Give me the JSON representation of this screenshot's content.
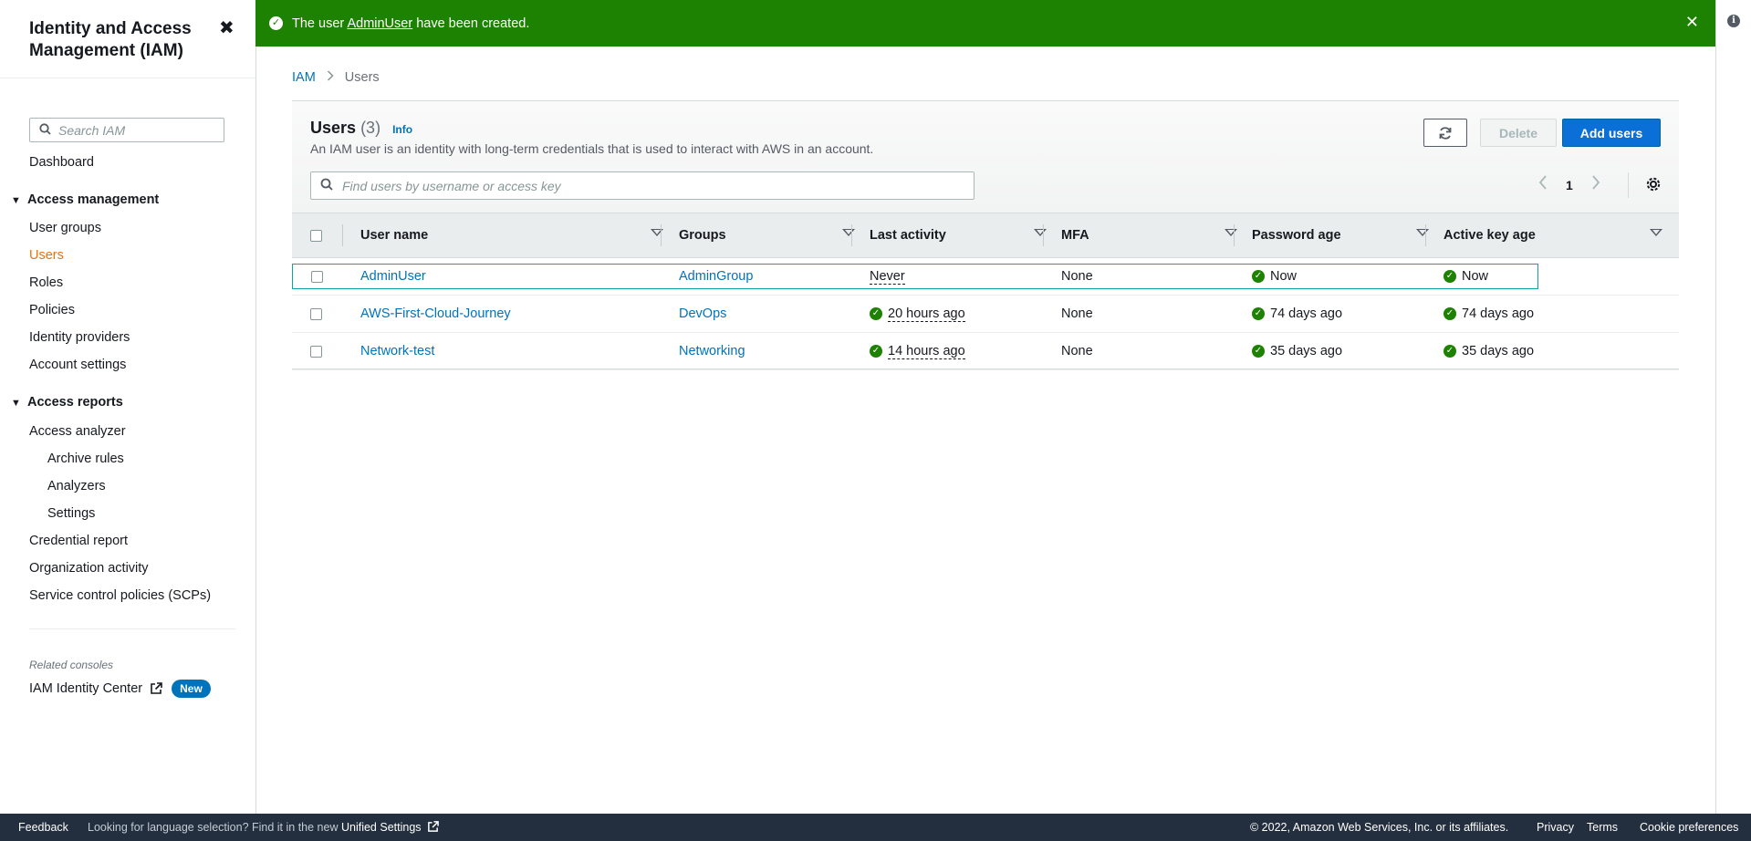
{
  "sidebar": {
    "title": "Identity and Access Management (IAM)",
    "close_glyph": "✖",
    "search_placeholder": "Search IAM",
    "dashboard": "Dashboard",
    "access_management": {
      "label": "Access management",
      "items": [
        "User groups",
        "Users",
        "Roles",
        "Policies",
        "Identity providers",
        "Account settings"
      ],
      "active": "Users"
    },
    "access_reports": {
      "label": "Access reports",
      "items": {
        "access_analyzer": "Access analyzer",
        "archive_rules": "Archive rules",
        "analyzers": "Analyzers",
        "settings": "Settings",
        "credential_report": "Credential report",
        "organization_activity": "Organization activity",
        "scps": "Service control policies (SCPs)"
      }
    },
    "related_consoles": "Related consoles",
    "identity_center": "IAM Identity Center",
    "new_badge": "New"
  },
  "flash": {
    "prefix": "The user ",
    "user": "AdminUser",
    "suffix": " have been created.",
    "color": "#1d8102"
  },
  "breadcrumb": {
    "root": "IAM",
    "current": "Users"
  },
  "users": {
    "title": "Users",
    "count": "(3)",
    "info": "Info",
    "description": "An IAM user is an identity with long-term credentials that is used to interact with AWS in an account.",
    "delete_label": "Delete",
    "add_label": "Add users",
    "search_placeholder": "Find users by username or access key",
    "page": "1",
    "columns": [
      "User name",
      "Groups",
      "Last activity",
      "MFA",
      "Password age",
      "Active key age"
    ],
    "rows": [
      {
        "user": "AdminUser",
        "group": "AdminGroup",
        "last_activity": "Never",
        "mfa": "None",
        "password_age": "Now",
        "key_age": "Now"
      },
      {
        "user": "AWS-First-Cloud-Journey",
        "group": "DevOps",
        "last_activity": "20 hours ago",
        "mfa": "None",
        "password_age": "74 days ago",
        "key_age": "74 days ago"
      },
      {
        "user": "Network-test",
        "group": "Networking",
        "last_activity": "14 hours ago",
        "mfa": "None",
        "password_age": "35 days ago",
        "key_age": "35 days ago"
      }
    ]
  },
  "footer": {
    "feedback": "Feedback",
    "lang_text": "Looking for language selection? Find it in the new ",
    "unified": "Unified Settings",
    "copyright": "© 2022, Amazon Web Services, Inc. or its affiliates.",
    "privacy": "Privacy",
    "terms": "Terms",
    "cookies": "Cookie preferences"
  },
  "icons": [
    "close-icon",
    "search-icon",
    "triangle-down-icon",
    "external-link-icon",
    "check-circle-icon",
    "refresh-icon",
    "chevron-left-icon",
    "chevron-right-icon",
    "gear-icon",
    "sort-icon",
    "info-icon"
  ],
  "colors": {
    "link": "#0073bb",
    "active_nav": "#ec7211",
    "primary_button": "#0a6fd6",
    "footer": "#232f3e"
  }
}
